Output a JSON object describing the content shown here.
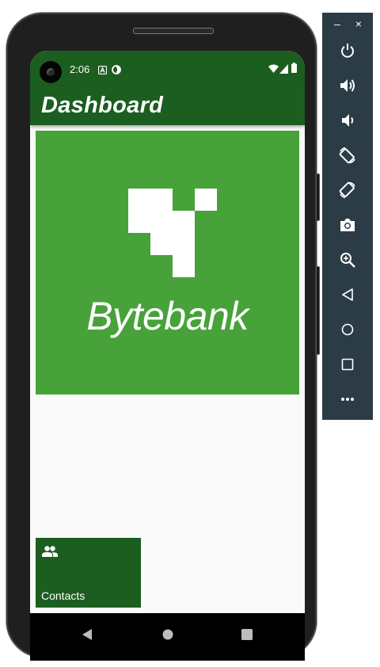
{
  "status_bar": {
    "time": "2:06",
    "icons": [
      "notification-a-icon",
      "data-saver-icon",
      "wifi-icon",
      "signal-icon",
      "battery-icon"
    ]
  },
  "app_bar": {
    "title": "Dashboard"
  },
  "logo": {
    "text": "Bytebank",
    "background": "#47a23a"
  },
  "dashboard": {
    "items": [
      {
        "label": "Contacts",
        "icon": "people-icon"
      }
    ]
  },
  "nav_bar": {
    "buttons": [
      "back-icon",
      "home-icon",
      "recents-icon"
    ]
  },
  "emulator_panel": {
    "window_controls": {
      "minimize": "–",
      "close": "×"
    },
    "buttons": [
      "power-icon",
      "volume-up-icon",
      "volume-down-icon",
      "rotate-left-icon",
      "rotate-right-icon",
      "camera-icon",
      "zoom-icon",
      "back-icon",
      "home-icon",
      "overview-icon",
      "more-icon"
    ]
  },
  "colors": {
    "primary": "#1b5e20",
    "logo_green": "#47a23a",
    "background": "#fafafa",
    "emulator_panel": "#2b3c47"
  }
}
